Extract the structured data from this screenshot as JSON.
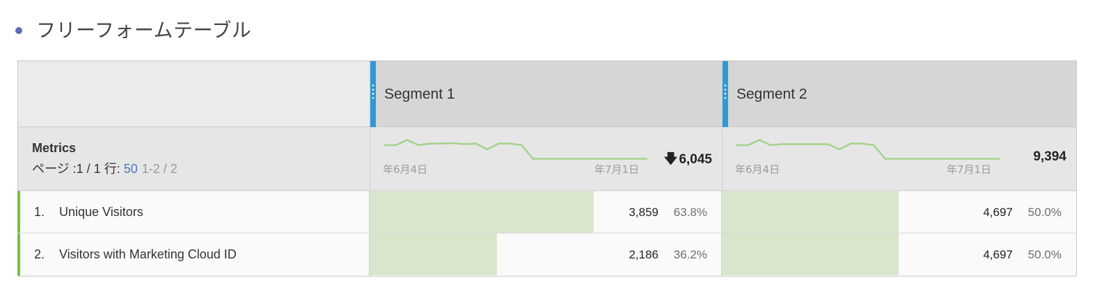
{
  "panel": {
    "title": "フリーフォームテーブル"
  },
  "metrics_header": {
    "title": "Metrics",
    "page_label": "ページ :",
    "page_value": "1 / 1",
    "rows_label": " 行:",
    "rows_value": "50",
    "range": "1-2 / 2"
  },
  "columns": [
    {
      "label": "Segment 1",
      "total": "6,045",
      "total_icon": "arrow-down-icon",
      "date_start": "年6月4日",
      "date_end": "年7月1日",
      "sparkline": [
        0.3,
        0.3,
        0.05,
        0.3,
        0.22,
        0.22,
        0.2,
        0.25,
        0.22,
        0.5,
        0.22,
        0.22,
        0.3,
        0.95,
        0.95,
        0.95,
        0.95,
        0.95,
        0.95,
        0.95,
        0.95,
        0.95,
        0.95,
        0.95
      ]
    },
    {
      "label": "Segment 2",
      "total": "9,394",
      "total_icon": "",
      "date_start": "年6月4日",
      "date_end": "年7月1日",
      "sparkline": [
        0.3,
        0.3,
        0.05,
        0.3,
        0.25,
        0.25,
        0.25,
        0.25,
        0.25,
        0.5,
        0.22,
        0.22,
        0.3,
        0.95,
        0.95,
        0.95,
        0.95,
        0.95,
        0.95,
        0.95,
        0.95,
        0.95,
        0.95,
        0.95
      ]
    }
  ],
  "rows": [
    {
      "rank": "1.",
      "label": "Unique Visitors",
      "cells": [
        {
          "value": "3,859",
          "percent": "63.8%",
          "fraction": 0.638
        },
        {
          "value": "4,697",
          "percent": "50.0%",
          "fraction": 0.5
        }
      ]
    },
    {
      "rank": "2.",
      "label": "Visitors with Marketing Cloud ID",
      "cells": [
        {
          "value": "2,186",
          "percent": "36.2%",
          "fraction": 0.362
        },
        {
          "value": "4,697",
          "percent": "50.0%",
          "fraction": 0.5
        }
      ]
    }
  ],
  "colors": {
    "sparkline": "#a5d28a",
    "bar": "#d8e7cc",
    "segment_handle": "#2d9ad7",
    "row_accent": "#76c043"
  }
}
